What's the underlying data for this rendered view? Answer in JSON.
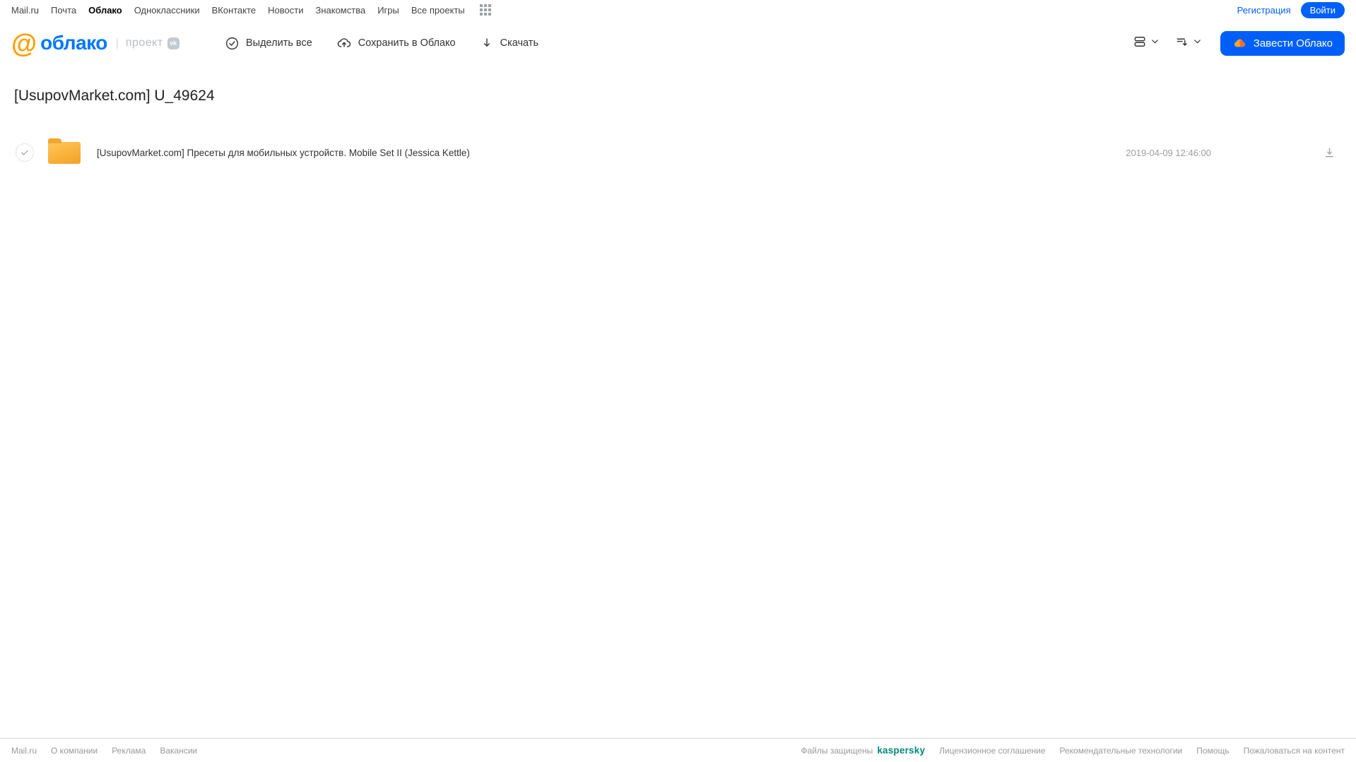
{
  "top_bar": {
    "links": [
      "Mail.ru",
      "Почта",
      "Облако",
      "Одноклассники",
      "ВКонтакте",
      "Новости",
      "Знакомства",
      "Игры",
      "Все проекты"
    ],
    "active_link": "Облако",
    "apps_icon": "grid-apps-icon",
    "register_label": "Регистрация",
    "login_label": "Войти"
  },
  "header": {
    "logo_at": "@",
    "logo_text": "облако",
    "project_pipe": "|",
    "project_label": "проект",
    "vk_badge": "vk",
    "toolbar": [
      {
        "label": "Выделить все",
        "icon": "check-circle-icon"
      },
      {
        "label": "Сохранить в Облако",
        "icon": "cloud-upload-icon"
      },
      {
        "label": "Скачать",
        "icon": "download-icon"
      }
    ],
    "view_controls": [
      "view-mode-icon",
      "sort-order-icon"
    ],
    "create_cloud_label": "Завести Облако",
    "create_cloud_icon": "cloud-icon"
  },
  "main": {
    "title": "[UsupovMarket.com] U_49624",
    "files": [
      {
        "type": "folder",
        "name": "[UsupovMarket.com] Пресеты для мобильных устройств. Mobile Set II (Jessica Kettle)",
        "date": "2019-04-09 12:46:00",
        "selected": false
      }
    ]
  },
  "footer": {
    "left_links": [
      "Mail.ru",
      "О компании",
      "Реклама",
      "Вакансии"
    ],
    "protected_text": "Файлы защищены",
    "kaspersky_label": "kaspersky",
    "right_links": [
      "Лицензионное соглашение",
      "Рекомендательные технологии",
      "Помощь",
      "Пожаловаться на контент"
    ]
  },
  "colors": {
    "accent_blue": "#005FF9",
    "logo_blue": "#0077FF",
    "logo_orange": "#FF9E00",
    "folder_yellow": "#F7AC33",
    "kaspersky_teal": "#00897d",
    "footer_gray": "#9a9a9a"
  }
}
